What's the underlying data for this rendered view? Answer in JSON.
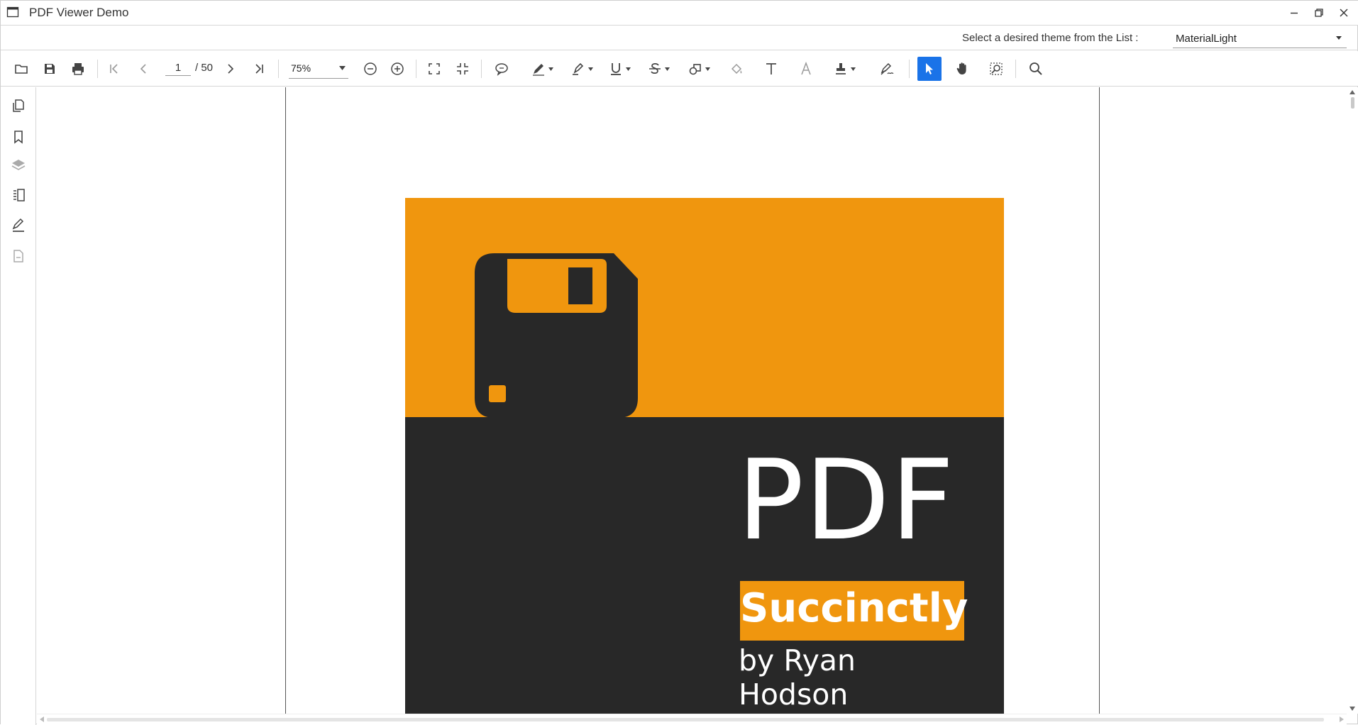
{
  "window": {
    "title": "PDF Viewer Demo"
  },
  "theme_bar": {
    "label": "Select a desired theme from the List :",
    "selected_theme": "MaterialLight"
  },
  "toolbar": {
    "current_page": "1",
    "total_pages": "/ 50",
    "zoom": "75%",
    "buttons": [
      "open-file",
      "save",
      "print",
      "first-page",
      "previous-page",
      "next-page",
      "last-page",
      "zoom-out",
      "zoom-in",
      "fit-page",
      "fit-width",
      "sticky-note",
      "ink",
      "highlight",
      "underline",
      "strikethrough",
      "shapes",
      "fill",
      "free-text",
      "text-markup",
      "stamp",
      "signature",
      "select-tool",
      "pan-tool",
      "marquee-zoom",
      "search"
    ],
    "active_tool": "select-tool",
    "accent_color": "#1a73e8"
  },
  "left_panel": {
    "buttons": [
      "page-thumbnails",
      "bookmarks",
      "layers",
      "organize-pages",
      "form-fields",
      "attachments"
    ]
  },
  "document": {
    "cover_title": "PDF",
    "cover_badge": "Succinctly",
    "cover_author": "by Ryan Hodson",
    "colors": {
      "orange": "#f0960e",
      "dark": "#282828"
    }
  }
}
